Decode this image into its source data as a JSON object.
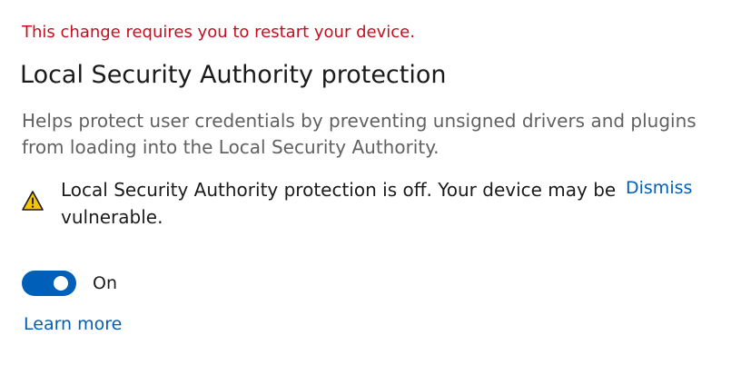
{
  "restart_notice": "This change requires you to restart your device.",
  "setting": {
    "title": "Local Security Authority protection",
    "description": "Helps protect user credentials by preventing unsigned drivers and plugins from loading into the Local Security Authority."
  },
  "warning": {
    "icon": "warning-triangle-icon",
    "text": "Local Security Authority protection is off. Your device may be vulnerable.",
    "dismiss_label": "Dismiss"
  },
  "toggle": {
    "state": "on",
    "label": "On"
  },
  "learn_more_label": "Learn more",
  "colors": {
    "error_text": "#c50f1f",
    "accent": "#005fb8",
    "warning_fill": "#f7c400"
  }
}
